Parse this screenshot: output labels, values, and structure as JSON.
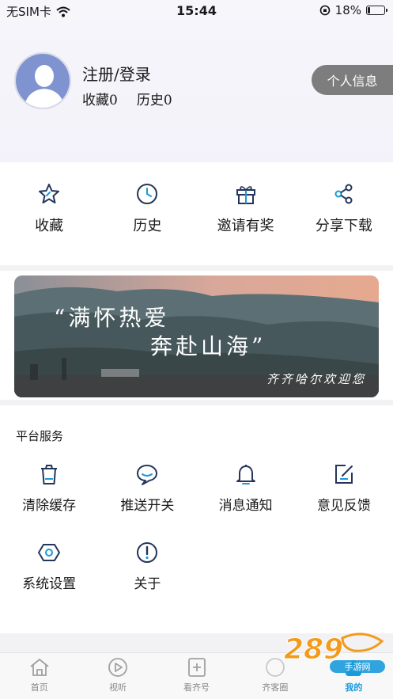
{
  "status_bar": {
    "carrier": "无SIM卡",
    "time": "15:44",
    "battery": "18%",
    "battery_level": 0.18
  },
  "profile": {
    "username": "注册/登录",
    "favorites": "收藏0",
    "history": "历史0",
    "profile_button": "个人信息"
  },
  "quick_actions": [
    {
      "label": "收藏",
      "icon": "star-icon"
    },
    {
      "label": "历史",
      "icon": "clock-icon"
    },
    {
      "label": "邀请有奖",
      "icon": "gift-icon"
    },
    {
      "label": "分享下载",
      "icon": "share-icon"
    }
  ],
  "banner": {
    "line1": "“满怀热爱",
    "line2": "奔赴山海”",
    "line3": "齐齐哈尔欢迎您"
  },
  "services": {
    "title": "平台服务",
    "items": [
      {
        "label": "清除缓存",
        "icon": "trash-icon"
      },
      {
        "label": "推送开关",
        "icon": "chat-bubble-icon"
      },
      {
        "label": "消息通知",
        "icon": "bell-icon"
      },
      {
        "label": "意见反馈",
        "icon": "edit-icon"
      },
      {
        "label": "系统设置",
        "icon": "settings-hexagon-icon"
      },
      {
        "label": "关于",
        "icon": "info-icon"
      }
    ]
  },
  "tab_bar": [
    {
      "label": "首页",
      "icon": "home-icon"
    },
    {
      "label": "视听",
      "icon": "play-icon"
    },
    {
      "label": "看齐号",
      "icon": "plus-square-icon"
    },
    {
      "label": "齐客圈",
      "icon": "circle-icon"
    },
    {
      "label": "我的",
      "icon": "profile-icon",
      "active": true
    }
  ],
  "watermark": {
    "text": "289",
    "sub": "手游网"
  },
  "colors": {
    "accent": "#1a9ad9",
    "profile_button": "#7d7d7d",
    "avatar": "#7e93cf",
    "icon_navy": "#24365b"
  }
}
